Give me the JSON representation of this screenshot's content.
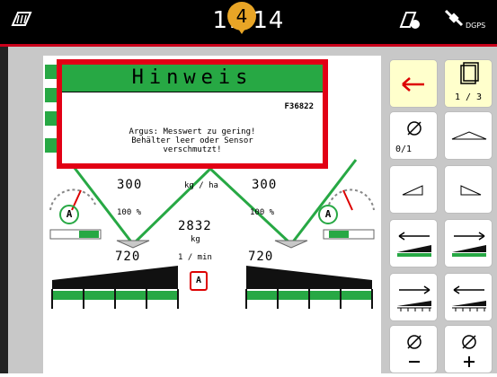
{
  "status_bar": {
    "time": "11:14",
    "callout_number": "4",
    "gps_label": "DGPS"
  },
  "dialog": {
    "title": "Hinweis",
    "code": "F36822",
    "message_line1": "Argus: Messwert zu gering!",
    "message_line2": "Behälter leer oder Sensor",
    "message_line3": "verschmutzt!"
  },
  "spreader": {
    "left_rate": "300",
    "rate_unit": "kg / ha",
    "right_rate": "300",
    "left_percent": "100 %",
    "right_percent": "100 %",
    "hopper_amount": "2832",
    "hopper_unit": "kg",
    "left_disc_speed": "720",
    "speed_unit": "1 / min",
    "right_disc_speed": "720",
    "auto_label": "A"
  },
  "side_buttons": {
    "page_indicator": "1 / 3",
    "section_toggle_label": "0/1"
  },
  "colors": {
    "accent_red": "#e20015",
    "header_green": "#27a844",
    "highlight_yellow": "#ffffcc"
  }
}
